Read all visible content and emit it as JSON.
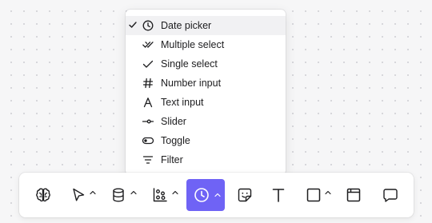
{
  "menu": {
    "items": [
      {
        "label": "Date picker",
        "icon": "clock-icon",
        "selected": true
      },
      {
        "label": "Multiple select",
        "icon": "double-check-icon",
        "selected": false
      },
      {
        "label": "Single select",
        "icon": "check-icon",
        "selected": false
      },
      {
        "label": "Number input",
        "icon": "hash-icon",
        "selected": false
      },
      {
        "label": "Text input",
        "icon": "letter-a-icon",
        "selected": false
      },
      {
        "label": "Slider",
        "icon": "slider-icon",
        "selected": false
      },
      {
        "label": "Toggle",
        "icon": "toggle-icon",
        "selected": false
      },
      {
        "label": "Filter",
        "icon": "filter-icon",
        "selected": false
      }
    ]
  },
  "toolbar": {
    "tools": [
      {
        "name": "ai-brain-tool",
        "icon": "brain-icon"
      },
      {
        "name": "pointer-tool",
        "icon": "cursor-icon",
        "has_dropdown": true
      },
      {
        "name": "database-tool",
        "icon": "database-icon",
        "has_dropdown": true
      },
      {
        "name": "chart-tool",
        "icon": "scatter-chart-icon",
        "has_dropdown": true
      },
      {
        "name": "input-tool",
        "icon": "clock-icon",
        "has_dropdown": true,
        "active": true
      },
      {
        "name": "sticker-tool",
        "icon": "sticker-icon"
      },
      {
        "name": "text-tool",
        "icon": "text-t-icon",
        "glyph": "T"
      },
      {
        "name": "shape-tool",
        "icon": "square-icon",
        "has_dropdown": true
      },
      {
        "name": "frame-tool",
        "icon": "frame-icon"
      },
      {
        "name": "comment-tool",
        "icon": "comment-icon"
      }
    ]
  },
  "colors": {
    "accent": "#6f63f5",
    "menu_selected_bg": "#f1f1f3",
    "canvas_bg": "#f6f6f7"
  }
}
